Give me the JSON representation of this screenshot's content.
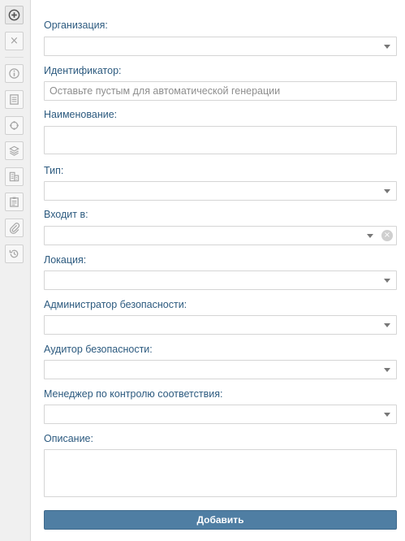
{
  "sidebar": {
    "buttons": [
      {
        "icon": "add-circle-icon"
      },
      {
        "icon": "close-icon",
        "glyph": "×"
      },
      {
        "icon": "info-icon"
      },
      {
        "icon": "document-icon"
      },
      {
        "icon": "cycle-icon"
      },
      {
        "icon": "layers-icon"
      },
      {
        "icon": "building-icon"
      },
      {
        "icon": "clipboard-icon"
      },
      {
        "icon": "paperclip-icon"
      },
      {
        "icon": "history-icon"
      }
    ]
  },
  "form": {
    "organization_label": "Организация:",
    "identifier_label": "Идентификатор:",
    "identifier_placeholder": "Оставьте пустым для автоматической генерации",
    "name_label": "Наименование:",
    "type_label": "Тип:",
    "parent_label": "Входит в:",
    "location_label": "Локация:",
    "security_admin_label": "Администратор безопасности:",
    "security_auditor_label": "Аудитор безопасности:",
    "compliance_manager_label": "Менеджер по контролю соответствия:",
    "description_label": "Описание:",
    "clear_glyph": "×",
    "submit_label": "Добавить"
  },
  "colors": {
    "label": "#2c5a7f",
    "submit_button": "#4f7ea3",
    "sidebar_bg": "#f0f0f0",
    "field_border": "#d5d5d5"
  }
}
